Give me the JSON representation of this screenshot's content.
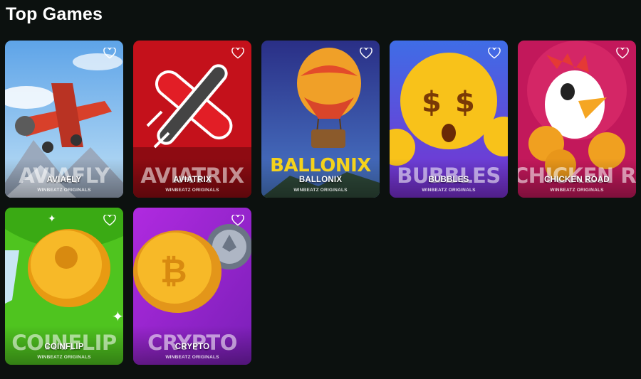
{
  "section": {
    "title": "Top Games"
  },
  "games": [
    {
      "name": "AVIAFLY",
      "bigword": "AVIAFLY",
      "provider": "WINBEATZ ORIGINALS",
      "bg": "#7fb8ea",
      "icon": "heart-icon"
    },
    {
      "name": "AVIATRIX",
      "bigword": "AVIATRIX",
      "provider": "WINBEATZ ORIGINALS",
      "bg": "#c4111b",
      "icon": "heart-icon"
    },
    {
      "name": "BALLONIX",
      "bigword": "BALLONIX",
      "provider": "WINBEATZ ORIGINALS",
      "bg": "#2f3f9a",
      "icon": "heart-icon"
    },
    {
      "name": "BUBBLES",
      "bigword": "BUBBLES",
      "provider": "WINBEATZ ORIGINALS",
      "bg": "#5a3fd8",
      "icon": "heart-icon"
    },
    {
      "name": "CHICKEN ROAD",
      "bigword": "CHICKEN ROAD",
      "provider": "WINBEATZ ORIGINALS",
      "bg": "#c2185b",
      "icon": "heart-icon"
    },
    {
      "name": "COINFLIP",
      "bigword": "COINFLIP",
      "provider": "WINBEATZ ORIGINALS",
      "bg": "#4fc41f",
      "icon": "heart-icon"
    },
    {
      "name": "CRYPTO",
      "bigword": "CRYPTO",
      "provider": "WINBEATZ ORIGINALS",
      "bg": "#9c27d6",
      "icon": "heart-icon"
    }
  ]
}
